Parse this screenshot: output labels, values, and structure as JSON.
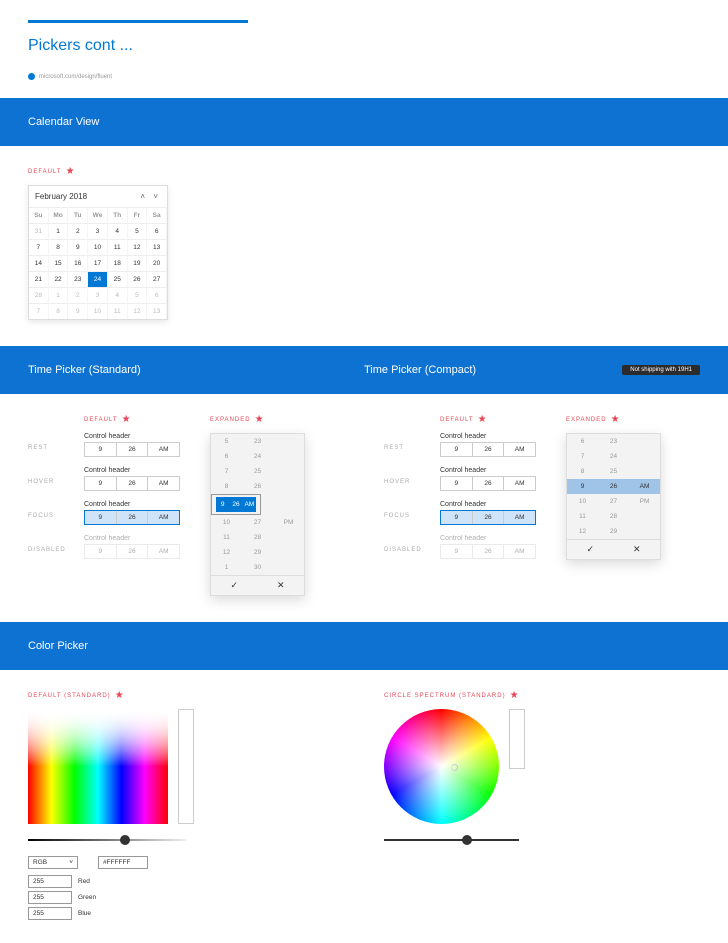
{
  "page_title": "Pickers cont ...",
  "source_url": "microsoft.com/design/fluent",
  "sections": {
    "calendar": {
      "header": "Calendar View",
      "tag": "DEFAULT",
      "month_label": "February 2018",
      "dow": [
        "Su",
        "Mo",
        "Tu",
        "We",
        "Th",
        "Fr",
        "Sa"
      ],
      "rows": [
        [
          "31",
          "1",
          "2",
          "3",
          "4",
          "5",
          "6"
        ],
        [
          "7",
          "8",
          "9",
          "10",
          "11",
          "12",
          "13"
        ],
        [
          "14",
          "15",
          "16",
          "17",
          "18",
          "19",
          "20"
        ],
        [
          "21",
          "22",
          "23",
          "24",
          "25",
          "26",
          "27"
        ],
        [
          "28",
          "1",
          "2",
          "3",
          "4",
          "5",
          "6"
        ],
        [
          "7",
          "8",
          "9",
          "10",
          "11",
          "12",
          "13"
        ]
      ],
      "selected_day": "24",
      "out_of_month": [
        "31"
      ]
    },
    "time_standard": {
      "header": "Time Picker (Standard)",
      "default_tag": "DEFAULT",
      "expanded_tag": "EXPANDED",
      "states": [
        "REST",
        "HOVER",
        "FOCUS",
        "DISABLED"
      ],
      "control_header": "Control header",
      "value": {
        "hour": "9",
        "minute": "26",
        "ampm": "AM"
      },
      "expanded_rows": [
        [
          "5",
          "23",
          ""
        ],
        [
          "6",
          "24",
          ""
        ],
        [
          "7",
          "25",
          ""
        ],
        [
          "8",
          "26",
          ""
        ],
        [
          "9",
          "26",
          "AM"
        ],
        [
          "10",
          "27",
          "PM"
        ],
        [
          "11",
          "28",
          ""
        ],
        [
          "12",
          "29",
          ""
        ],
        [
          "1",
          "30",
          ""
        ]
      ]
    },
    "time_compact": {
      "header": "Time Picker (Compact)",
      "badge": "Not shipping with 19H1",
      "default_tag": "DEFAULT",
      "expanded_tag": "EXPANDED",
      "states": [
        "REST",
        "HOVER",
        "FOCUS",
        "DISABLED"
      ],
      "control_header": "Control header",
      "value": {
        "hour": "9",
        "minute": "26",
        "ampm": "AM"
      },
      "expanded_rows": [
        [
          "6",
          "23",
          ""
        ],
        [
          "7",
          "24",
          ""
        ],
        [
          "8",
          "25",
          ""
        ],
        [
          "9",
          "26",
          "AM"
        ],
        [
          "10",
          "27",
          "PM"
        ],
        [
          "11",
          "28",
          ""
        ],
        [
          "12",
          "29",
          ""
        ]
      ]
    },
    "color": {
      "header": "Color Picker",
      "default_tag": "DEFAULT (STANDARD)",
      "circle_tag": "CIRCLE SPECTRUM (STANDARD)",
      "mode": "RGB",
      "hex": "#FFFFFF",
      "r": "255",
      "g": "255",
      "b": "255",
      "r_label": "Red",
      "g_label": "Green",
      "b_label": "Blue"
    }
  }
}
